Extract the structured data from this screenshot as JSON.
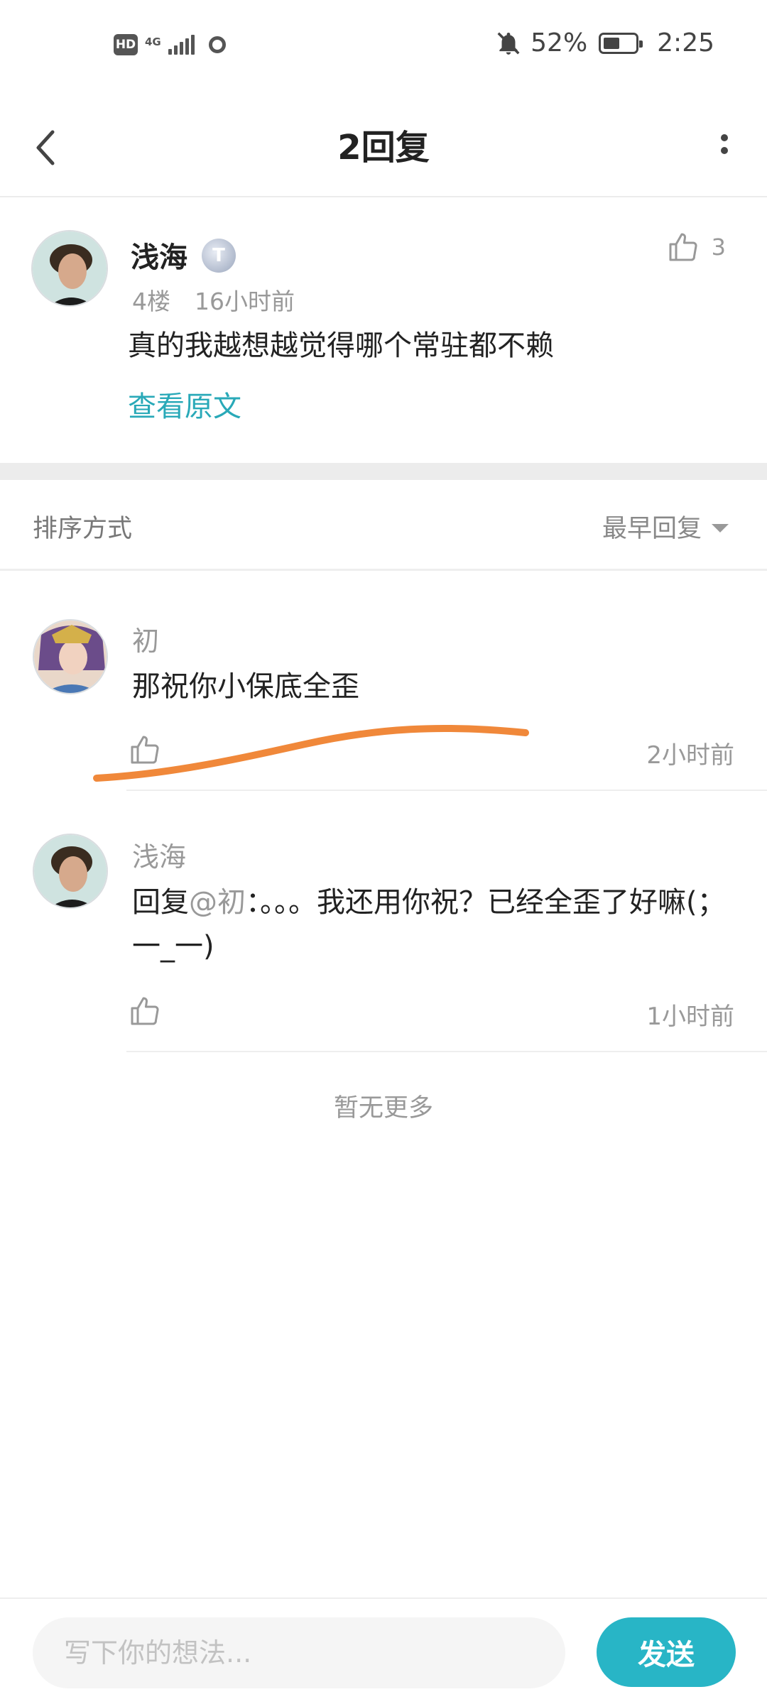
{
  "status_bar": {
    "hd": "HD",
    "network": "4G",
    "battery_percent_text": "52%",
    "battery_level": 0.52,
    "time": "2:25",
    "icons": [
      "hd-icon",
      "signal-icon",
      "sync-icon",
      "bell-off-icon",
      "battery-icon"
    ]
  },
  "header": {
    "title": "2回复",
    "back_icon": "chevron-left-icon",
    "more_icon": "more-vertical-icon"
  },
  "original_post": {
    "author": "浅海",
    "level_badge": "T",
    "floor": "4楼",
    "time": "16小时前",
    "text": "真的我越想越觉得哪个常驻都不赖",
    "view_original": "查看原文",
    "likes": "3"
  },
  "sort": {
    "label": "排序方式",
    "value": "最早回复"
  },
  "replies": [
    {
      "author": "初",
      "text": "那祝你小保底全歪",
      "time": "2小时前"
    },
    {
      "author": "浅海",
      "reply_prefix": "回复",
      "mention": "@初",
      "text": "：。。。我还用你祝？已经全歪了好嘛(；一_一)",
      "time": "1小时前"
    }
  ],
  "no_more": "暂无更多",
  "input": {
    "placeholder": "写下你的想法...",
    "send_label": "发送"
  },
  "colors": {
    "accent": "#28b5c6",
    "link": "#29a9b8",
    "annotation_stroke": "#f0883a"
  }
}
